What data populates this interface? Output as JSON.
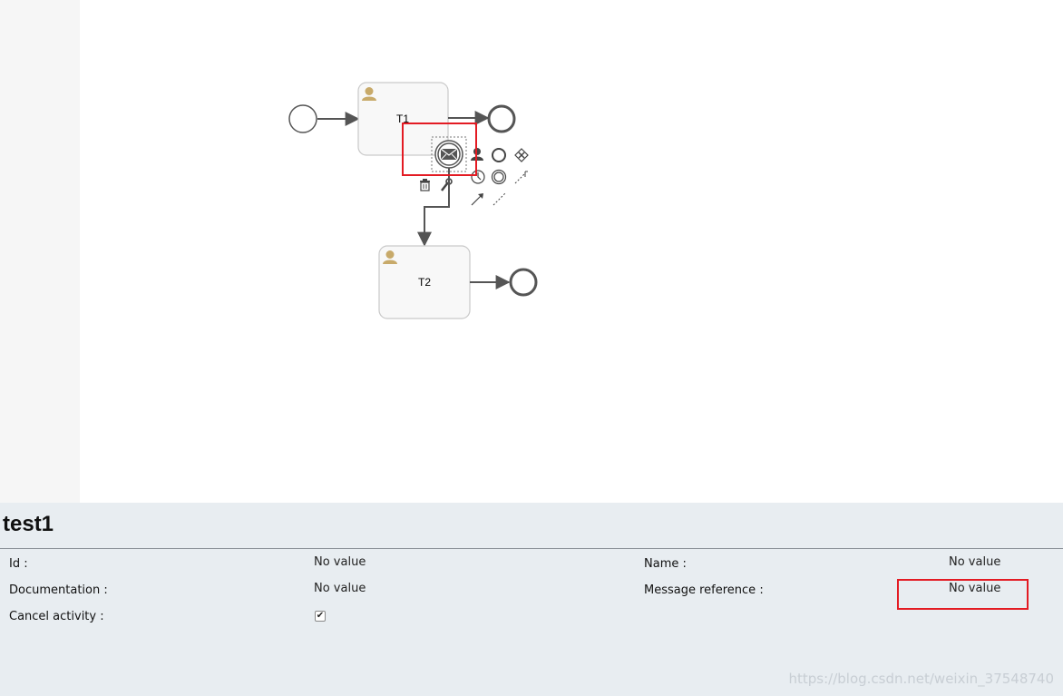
{
  "diagram": {
    "tasks": [
      {
        "label": "T1"
      },
      {
        "label": "T2"
      }
    ],
    "context_pad_icons": [
      "envelope-icon",
      "user-task-icon",
      "circle-event-icon",
      "gateway-icon",
      "timer-icon",
      "intermediate-event-icon",
      "text-annotation-icon",
      "trash-icon",
      "wrench-icon",
      "sequence-flow-icon",
      "association-icon"
    ],
    "colors": {
      "highlight": "#e31b23",
      "task_fill": "#f8f8f8",
      "task_stroke": "#c9c9c9",
      "user_icon": "#c8aa6a",
      "flow": "#555555"
    }
  },
  "properties": {
    "title": "test1",
    "rows": [
      {
        "label": "Id :",
        "value": "No value"
      },
      {
        "label": "Documentation :",
        "value": "No value"
      },
      {
        "label": "Cancel activity :",
        "value": "✔"
      },
      {
        "label": "Name :",
        "value": "No value"
      },
      {
        "label": "Message reference :",
        "value": "No value"
      }
    ]
  },
  "watermark": "https://blog.csdn.net/weixin_37548740"
}
